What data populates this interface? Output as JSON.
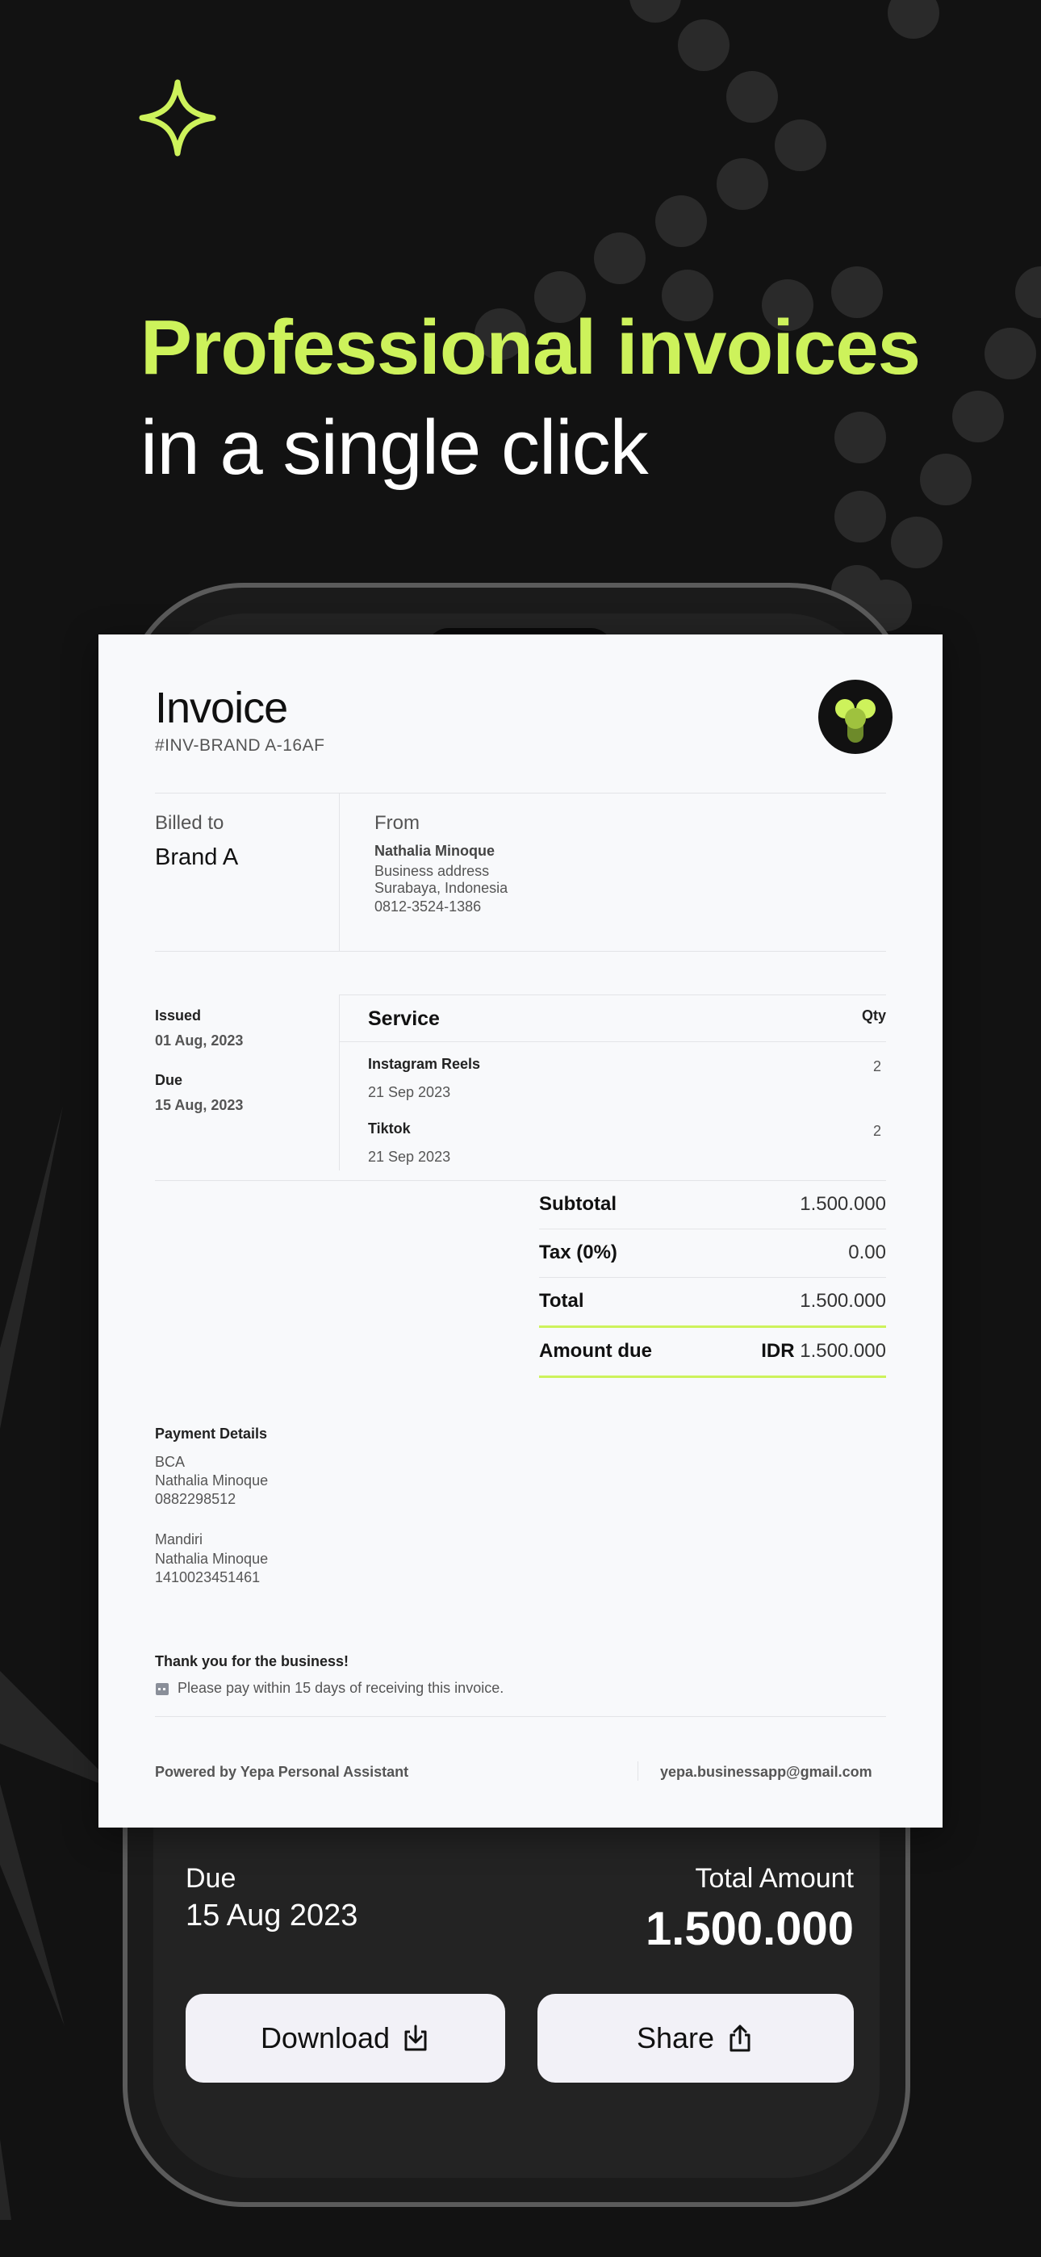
{
  "headline": {
    "line1": "Professional invoices",
    "line2": "in a single click"
  },
  "colors": {
    "accent": "#cdf25b",
    "background": "#121212",
    "paper": "#f8f9fb"
  },
  "invoice": {
    "title": "Invoice",
    "number": "#INV-BRAND A-16AF",
    "billed_to_label": "Billed to",
    "billed_to_value": "Brand A",
    "from_label": "From",
    "from_name": "Nathalia Minoque",
    "from_address": "Business address",
    "from_city": "Surabaya, Indonesia",
    "from_phone": "0812-3524-1386",
    "issued_label": "Issued",
    "issued_date": "01 Aug, 2023",
    "due_label": "Due",
    "due_date": "15 Aug, 2023",
    "service_header": "Service",
    "qty_header": "Qty",
    "services": [
      {
        "name": "Instagram Reels",
        "date": "21 Sep 2023",
        "qty": "2"
      },
      {
        "name": "Tiktok",
        "date": "21 Sep 2023",
        "qty": "2"
      }
    ],
    "totals": {
      "subtotal_label": "Subtotal",
      "subtotal_value": "1.500.000",
      "tax_label": "Tax (0%)",
      "tax_value": "0.00",
      "total_label": "Total",
      "total_value": "1.500.000",
      "amount_due_label": "Amount due",
      "amount_due_currency": "IDR",
      "amount_due_value": "1.500.000"
    },
    "payment": {
      "title": "Payment Details",
      "bank1": "BCA",
      "bank1_name": "Nathalia Minoque",
      "bank1_account": "0882298512",
      "bank2": "Mandiri",
      "bank2_name": "Nathalia Minoque",
      "bank2_account": "1410023451461"
    },
    "thanks": "Thank you for the business!",
    "note": "Please pay within 15 days of receiving this invoice.",
    "powered_by": "Powered by Yepa Personal Assistant",
    "email": "yepa.businessapp@gmail.com"
  },
  "summary": {
    "due_label": "Due",
    "due_date": "15 Aug 2023",
    "total_label": "Total Amount",
    "total_value": "1.500.000"
  },
  "actions": {
    "download_label": "Download",
    "download_icon": "download-tray-icon",
    "share_label": "Share",
    "share_icon": "share-icon"
  }
}
